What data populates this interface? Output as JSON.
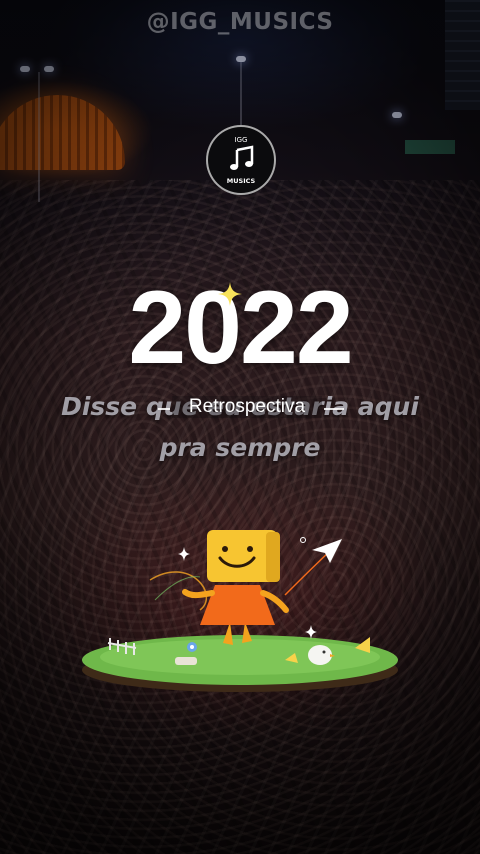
{
  "watermark": "@IGG_MUSICS",
  "logo": {
    "top_text": "IGG",
    "bottom_text": "MUSICS",
    "icon": "music-note-icon"
  },
  "year": "2022",
  "lyrics": {
    "line1": "Disse que eu estaria aqui",
    "line2": "pra sempre"
  },
  "retrospective_label": "Retrospectiva",
  "colors": {
    "accent_orange": "#f5a524",
    "grass": "#6fb84a",
    "mascot_yellow": "#f7c531",
    "dress_orange": "#f26a1b"
  },
  "icons": [
    "sparkle-icon",
    "paper-plane-icon",
    "mascot-illustration"
  ]
}
